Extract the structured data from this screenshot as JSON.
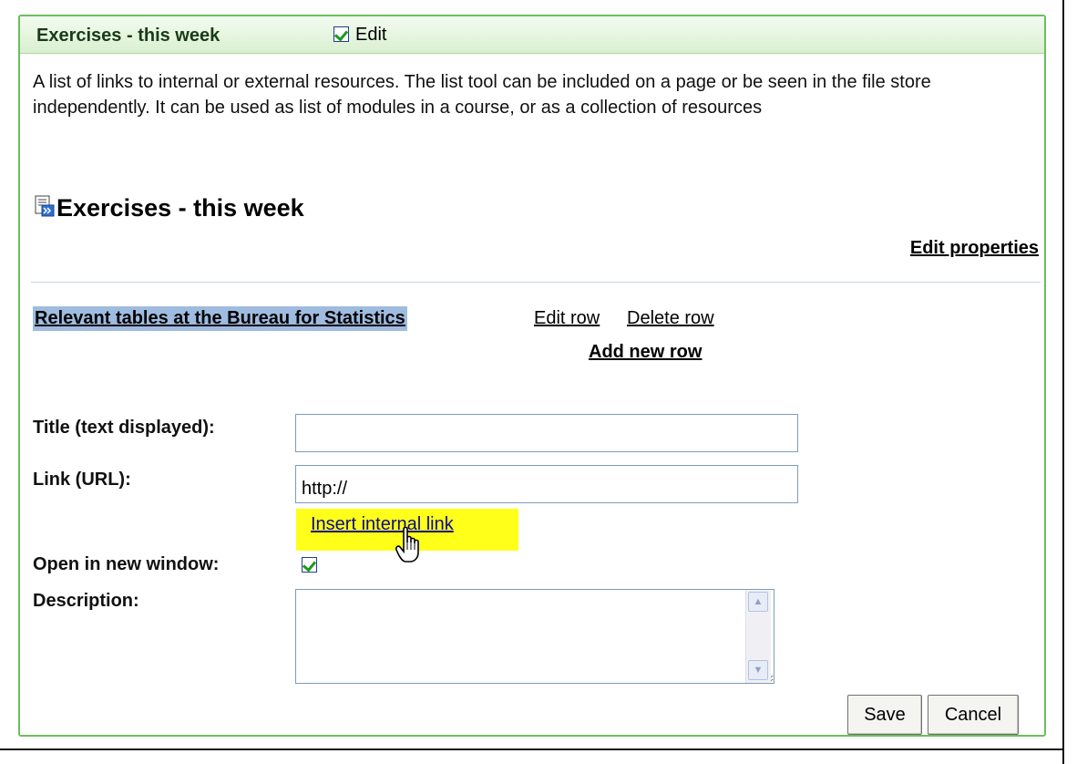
{
  "panel": {
    "header_title": "Exercises - this week",
    "edit_label": "Edit",
    "edit_checked": true,
    "description": "A list of links to internal or external resources. The list tool can be included on a page or be seen in the file store independently. It can be used as list of modules in a course, or as a collection of resources",
    "list_title": "Exercises - this week",
    "edit_properties": "Edit properties"
  },
  "row": {
    "title": "Relevant tables at the Bureau for Statistics",
    "edit_row": "Edit row",
    "delete_row": "Delete row",
    "add_new_row": "Add new row"
  },
  "form": {
    "title_label": "Title (text displayed):",
    "title_value": "",
    "link_label": "Link (URL):",
    "link_value": "http://",
    "insert_internal_link": "Insert internal link",
    "new_window_label": "Open in new window:",
    "new_window_checked": true,
    "description_label": "Description:",
    "description_value": "",
    "save": "Save",
    "cancel": "Cancel"
  },
  "colors": {
    "header_border": "#6cbe5c",
    "row_highlight": "#9fbce0",
    "insert_link_highlight": "#ffff1a"
  }
}
